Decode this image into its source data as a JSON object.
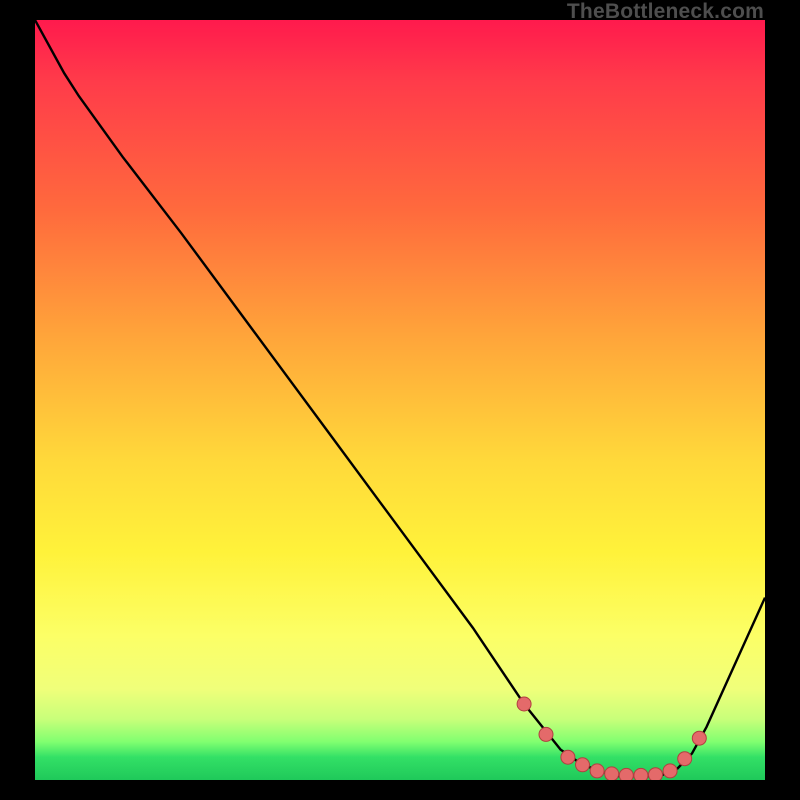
{
  "watermark": {
    "text": "TheBottleneck.com"
  },
  "colors": {
    "background": "#000000",
    "curve": "#000000",
    "marker_fill": "#E46A6A",
    "marker_stroke": "#B04040"
  },
  "chart_data": {
    "type": "line",
    "title": "",
    "xlabel": "",
    "ylabel": "",
    "xlim": [
      0,
      100
    ],
    "ylim": [
      0,
      100
    ],
    "series": [
      {
        "name": "bottleneck-curve",
        "x": [
          0,
          4,
          6,
          12,
          20,
          30,
          40,
          50,
          60,
          67,
          72,
          75,
          78,
          80,
          82,
          84,
          86,
          88,
          90,
          92,
          100
        ],
        "y": [
          100,
          93,
          90,
          82,
          72,
          59,
          46,
          33,
          20,
          10,
          4,
          2,
          1,
          0.5,
          0.5,
          0.5,
          0.7,
          1.5,
          3.5,
          7,
          24
        ]
      }
    ],
    "markers": {
      "name": "highlight-points",
      "x": [
        67,
        70,
        73,
        75,
        77,
        79,
        81,
        83,
        85,
        87,
        89,
        91
      ],
      "y": [
        10,
        6,
        3,
        2,
        1.2,
        0.8,
        0.6,
        0.6,
        0.7,
        1.2,
        2.8,
        5.5
      ]
    }
  }
}
